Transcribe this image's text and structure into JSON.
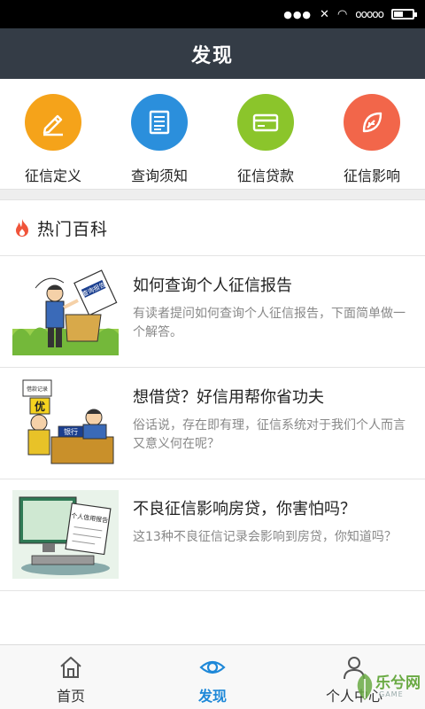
{
  "status_bar": {
    "signal": "ooooo"
  },
  "header": {
    "title": "发现"
  },
  "categories": [
    {
      "label": "征信定义",
      "icon": "pencil-icon",
      "color": "#f5a31a"
    },
    {
      "label": "查询须知",
      "icon": "document-icon",
      "color": "#2b8fdc"
    },
    {
      "label": "征信贷款",
      "icon": "card-icon",
      "color": "#8bc52b"
    },
    {
      "label": "征信影响",
      "icon": "leaf-icon",
      "color": "#f2664a"
    }
  ],
  "section": {
    "title": "热门百科"
  },
  "articles": [
    {
      "title": "如何查询个人征信报告",
      "desc": "有读者提问如何查询个人征信报告，下面简单做一个解答。",
      "thumb_text": "查询报告"
    },
    {
      "title": "想借贷？好信用帮你省功夫",
      "desc": "俗话说，存在即有理，征信系统对于我们个人而言又意义何在呢？",
      "thumb_text_1": "优",
      "thumb_text_2": "银行",
      "thumb_text_3": "借款记录"
    },
    {
      "title": "不良征信影响房贷，你害怕吗？",
      "desc": "这13种不良征信记录会影响到房贷，你知道吗？",
      "thumb_text": "个人信用报告"
    }
  ],
  "bottom_nav": [
    {
      "label": "首页",
      "icon": "home-icon",
      "active": false
    },
    {
      "label": "发现",
      "icon": "eye-icon",
      "active": true
    },
    {
      "label": "个人中心",
      "icon": "person-icon",
      "active": false
    }
  ],
  "watermark": {
    "text": "乐兮网",
    "sub": "GAME"
  },
  "colors": {
    "header_bg": "#343c46",
    "accent": "#1e88d8"
  }
}
